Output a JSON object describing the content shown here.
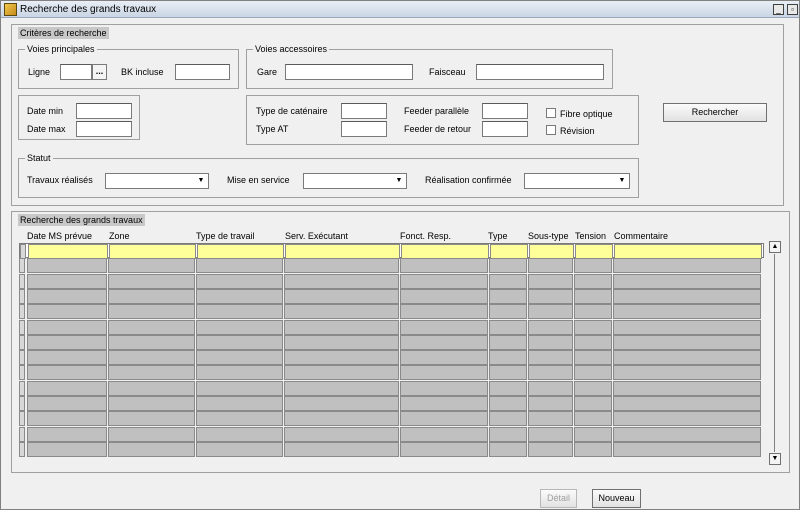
{
  "window": {
    "title": "Recherche des grands travaux",
    "minimize_glyph": "_",
    "restore_glyph": "▫"
  },
  "criteria": {
    "title": "Critères de recherche",
    "voies_principales": {
      "title": "Voies principales",
      "ligne_label": "Ligne",
      "ligne_value": "",
      "lov_glyph": "...",
      "bk_label": "BK incluse",
      "bk_value": ""
    },
    "voies_accessoires": {
      "title": "Voies accessoires",
      "gare_label": "Gare",
      "gare_value": "",
      "faisceau_label": "Faisceau",
      "faisceau_value": ""
    },
    "dates": {
      "date_min_label": "Date min",
      "date_min_value": "",
      "date_max_label": "Date max",
      "date_max_value": ""
    },
    "catenaire": {
      "type_catenaire_label": "Type de caténaire",
      "type_at_label": "Type AT",
      "feeder_parallele_label": "Feeder parallèle",
      "feeder_retour_label": "Feeder de retour",
      "fibre_label": "Fibre optique",
      "fibre_checked": false,
      "revision_label": "Révision",
      "revision_checked": false
    },
    "search_button": "Rechercher",
    "statut": {
      "title": "Statut",
      "travaux_label": "Travaux réalisés",
      "travaux_value": "",
      "mise_label": "Mise en service",
      "mise_value": "",
      "realisation_label": "Réalisation confirmée",
      "realisation_value": ""
    }
  },
  "results": {
    "title": "Recherche des grands travaux",
    "columns": [
      "Date MS prévue",
      "Zone",
      "Type de travail",
      "Serv. Exécutant",
      "Fonct. Resp.",
      "Type",
      "Sous-type",
      "Tension",
      "Commentaire"
    ],
    "row_count": 14
  },
  "footer": {
    "detail_button": "Détail",
    "nouveau_button": "Nouveau"
  },
  "colors": {
    "selected_row": "#ffff99",
    "empty_cell": "#c0c0c0"
  }
}
